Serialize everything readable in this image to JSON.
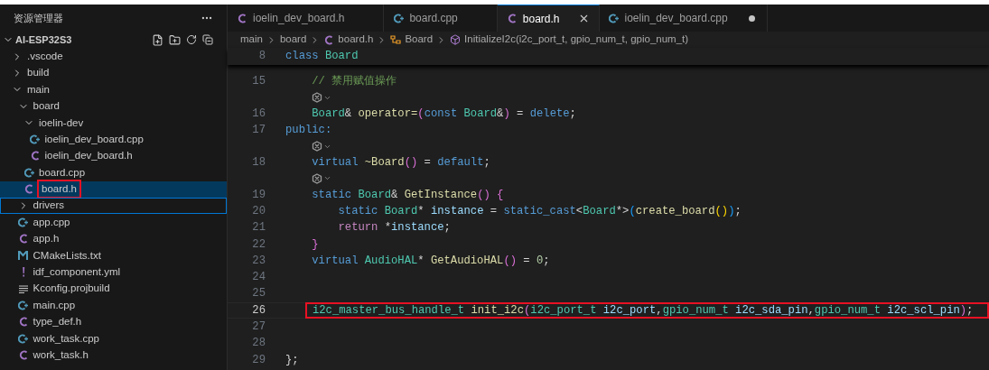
{
  "sidebar": {
    "title": "资源管理器",
    "project": {
      "name": "AI-ESP32S3",
      "expanded": true
    },
    "tree": [
      {
        "label": ".vscode",
        "kind": "folder",
        "expanded": false,
        "selected": false,
        "focused": false,
        "annotated": false
      },
      {
        "label": "build",
        "kind": "folder",
        "expanded": false,
        "selected": false,
        "focused": false,
        "annotated": false
      },
      {
        "label": "main",
        "kind": "folder",
        "expanded": true,
        "selected": false,
        "focused": false,
        "annotated": false,
        "children": [
          {
            "label": "board",
            "kind": "folder",
            "expanded": true,
            "selected": false,
            "focused": false,
            "annotated": false,
            "children": [
              {
                "label": "ioelin-dev",
                "kind": "folder",
                "expanded": true,
                "selected": false,
                "focused": false,
                "annotated": false,
                "children": [
                  {
                    "label": "ioelin_dev_board.cpp",
                    "kind": "cpp",
                    "selected": false,
                    "focused": false,
                    "annotated": false
                  },
                  {
                    "label": "ioelin_dev_board.h",
                    "kind": "h",
                    "selected": false,
                    "focused": false,
                    "annotated": false
                  }
                ]
              },
              {
                "label": "board.cpp",
                "kind": "cpp",
                "selected": false,
                "focused": false,
                "annotated": false
              },
              {
                "label": "board.h",
                "kind": "h",
                "selected": true,
                "focused": false,
                "annotated": true
              }
            ]
          },
          {
            "label": "drivers",
            "kind": "folder",
            "expanded": false,
            "selected": false,
            "focused": true,
            "annotated": false
          },
          {
            "label": "app.cpp",
            "kind": "cpp",
            "selected": false,
            "focused": false,
            "annotated": false
          },
          {
            "label": "app.h",
            "kind": "h",
            "selected": false,
            "focused": false,
            "annotated": false
          },
          {
            "label": "CMakeLists.txt",
            "kind": "cmake",
            "selected": false,
            "focused": false,
            "annotated": false
          },
          {
            "label": "idf_component.yml",
            "kind": "yml",
            "selected": false,
            "focused": false,
            "annotated": false
          },
          {
            "label": "Kconfig.projbuild",
            "kind": "text",
            "selected": false,
            "focused": false,
            "annotated": false
          },
          {
            "label": "main.cpp",
            "kind": "cpp",
            "selected": false,
            "focused": false,
            "annotated": false
          },
          {
            "label": "type_def.h",
            "kind": "h",
            "selected": false,
            "focused": false,
            "annotated": false
          },
          {
            "label": "work_task.cpp",
            "kind": "cpp",
            "selected": false,
            "focused": false,
            "annotated": false
          },
          {
            "label": "work_task.h",
            "kind": "h",
            "selected": false,
            "focused": false,
            "annotated": false
          }
        ]
      }
    ]
  },
  "tabs": [
    {
      "label": "ioelin_dev_board.h",
      "kind": "h",
      "selected": false,
      "modified": false
    },
    {
      "label": "board.cpp",
      "kind": "cpp",
      "selected": false,
      "modified": false
    },
    {
      "label": "board.h",
      "kind": "h",
      "selected": true,
      "modified": false
    },
    {
      "label": "ioelin_dev_board.cpp",
      "kind": "cpp",
      "selected": false,
      "modified": true
    }
  ],
  "breadcrumb": [
    {
      "label": "main",
      "kind": "folder"
    },
    {
      "label": "board",
      "kind": "folder"
    },
    {
      "label": "board.h",
      "kind": "h"
    },
    {
      "label": "Board",
      "kind": "class"
    },
    {
      "label": "InitializeI2c(i2c_port_t, gpio_num_t, gpio_num_t)",
      "kind": "method"
    }
  ],
  "sticky_line": {
    "number": "8",
    "tokens": [
      {
        "text": "class ",
        "kind": "keyword"
      },
      {
        "text": "Board",
        "kind": "type"
      }
    ]
  },
  "code_lines": [
    {
      "kind": "code",
      "number": "15",
      "annotated": false,
      "tokens": [
        {
          "text": "    // 禁用赋值操作",
          "kind": "comment"
        }
      ]
    },
    {
      "kind": "codelens"
    },
    {
      "kind": "code",
      "number": "16",
      "annotated": false,
      "tokens": [
        {
          "text": "    Board",
          "kind": "type"
        },
        {
          "text": "& ",
          "kind": "plain"
        },
        {
          "text": "operator=",
          "kind": "function"
        },
        {
          "text": "(",
          "kind": "paren"
        },
        {
          "text": "const ",
          "kind": "keyword"
        },
        {
          "text": "Board",
          "kind": "type"
        },
        {
          "text": "&",
          "kind": "plain"
        },
        {
          "text": ")",
          "kind": "paren"
        },
        {
          "text": " = ",
          "kind": "plain"
        },
        {
          "text": "delete",
          "kind": "keyword"
        },
        {
          "text": ";",
          "kind": "plain"
        }
      ]
    },
    {
      "kind": "code",
      "number": "17",
      "annotated": false,
      "tokens": [
        {
          "text": "public:",
          "kind": "keyword"
        }
      ]
    },
    {
      "kind": "codelens"
    },
    {
      "kind": "code",
      "number": "18",
      "annotated": false,
      "tokens": [
        {
          "text": "    virtual ",
          "kind": "keyword"
        },
        {
          "text": "~Board",
          "kind": "function"
        },
        {
          "text": "()",
          "kind": "paren"
        },
        {
          "text": " = ",
          "kind": "plain"
        },
        {
          "text": "default",
          "kind": "keyword"
        },
        {
          "text": ";",
          "kind": "plain"
        }
      ]
    },
    {
      "kind": "codelens"
    },
    {
      "kind": "code",
      "number": "19",
      "annotated": false,
      "tokens": [
        {
          "text": "    static ",
          "kind": "keyword"
        },
        {
          "text": "Board",
          "kind": "type"
        },
        {
          "text": "& ",
          "kind": "plain"
        },
        {
          "text": "GetInstance",
          "kind": "function"
        },
        {
          "text": "()",
          "kind": "paren"
        },
        {
          "text": " {",
          "kind": "paren"
        }
      ]
    },
    {
      "kind": "code",
      "number": "20",
      "annotated": false,
      "tokens": [
        {
          "text": "        static ",
          "kind": "keyword"
        },
        {
          "text": "Board",
          "kind": "type"
        },
        {
          "text": "* ",
          "kind": "plain"
        },
        {
          "text": "instance",
          "kind": "variable"
        },
        {
          "text": " = ",
          "kind": "plain"
        },
        {
          "text": "static_cast",
          "kind": "keyword"
        },
        {
          "text": "<",
          "kind": "plain"
        },
        {
          "text": "Board",
          "kind": "type"
        },
        {
          "text": "*>",
          "kind": "plain"
        },
        {
          "text": "(",
          "kind": "paren2"
        },
        {
          "text": "create_board",
          "kind": "function"
        },
        {
          "text": "()",
          "kind": "paren3"
        },
        {
          "text": ")",
          "kind": "paren2"
        },
        {
          "text": ";",
          "kind": "plain"
        }
      ]
    },
    {
      "kind": "code",
      "number": "21",
      "annotated": false,
      "tokens": [
        {
          "text": "        return",
          "kind": "control"
        },
        {
          "text": " *",
          "kind": "plain"
        },
        {
          "text": "instance",
          "kind": "variable"
        },
        {
          "text": ";",
          "kind": "plain"
        }
      ]
    },
    {
      "kind": "code",
      "number": "22",
      "annotated": false,
      "tokens": [
        {
          "text": "    }",
          "kind": "paren"
        }
      ]
    },
    {
      "kind": "code",
      "number": "23",
      "annotated": false,
      "tokens": [
        {
          "text": "    virtual ",
          "kind": "keyword"
        },
        {
          "text": "AudioHAL",
          "kind": "type"
        },
        {
          "text": "* ",
          "kind": "plain"
        },
        {
          "text": "GetAudioHAL",
          "kind": "function"
        },
        {
          "text": "()",
          "kind": "paren"
        },
        {
          "text": " = ",
          "kind": "plain"
        },
        {
          "text": "0",
          "kind": "number"
        },
        {
          "text": ";",
          "kind": "plain"
        }
      ]
    },
    {
      "kind": "code",
      "number": "24",
      "annotated": false
    },
    {
      "kind": "code",
      "number": "25",
      "annotated": false
    },
    {
      "kind": "code",
      "number": "26",
      "annotated": true,
      "tokens": [
        {
          "text": "i2c_master_bus_handle_t ",
          "kind": "type"
        },
        {
          "text": "init_i2c",
          "kind": "function"
        },
        {
          "text": "(",
          "kind": "paren"
        },
        {
          "text": "i2c_port_t ",
          "kind": "type"
        },
        {
          "text": "i2c_port",
          "kind": "variable"
        },
        {
          "text": ",",
          "kind": "plain"
        },
        {
          "text": "gpio_num_t ",
          "kind": "type"
        },
        {
          "text": "i2c_sda_pin",
          "kind": "variable"
        },
        {
          "text": ",",
          "kind": "plain"
        },
        {
          "text": "gpio_num_t ",
          "kind": "type"
        },
        {
          "text": "i2c_scl_pin",
          "kind": "variable"
        },
        {
          "text": ")",
          "kind": "paren"
        },
        {
          "text": ";",
          "kind": "plain"
        }
      ]
    },
    {
      "kind": "code",
      "number": "27",
      "annotated": false
    },
    {
      "kind": "code",
      "number": "28",
      "annotated": false
    },
    {
      "kind": "code",
      "number": "29",
      "annotated": false,
      "tokens": [
        {
          "text": "};",
          "kind": "plain"
        }
      ]
    }
  ]
}
